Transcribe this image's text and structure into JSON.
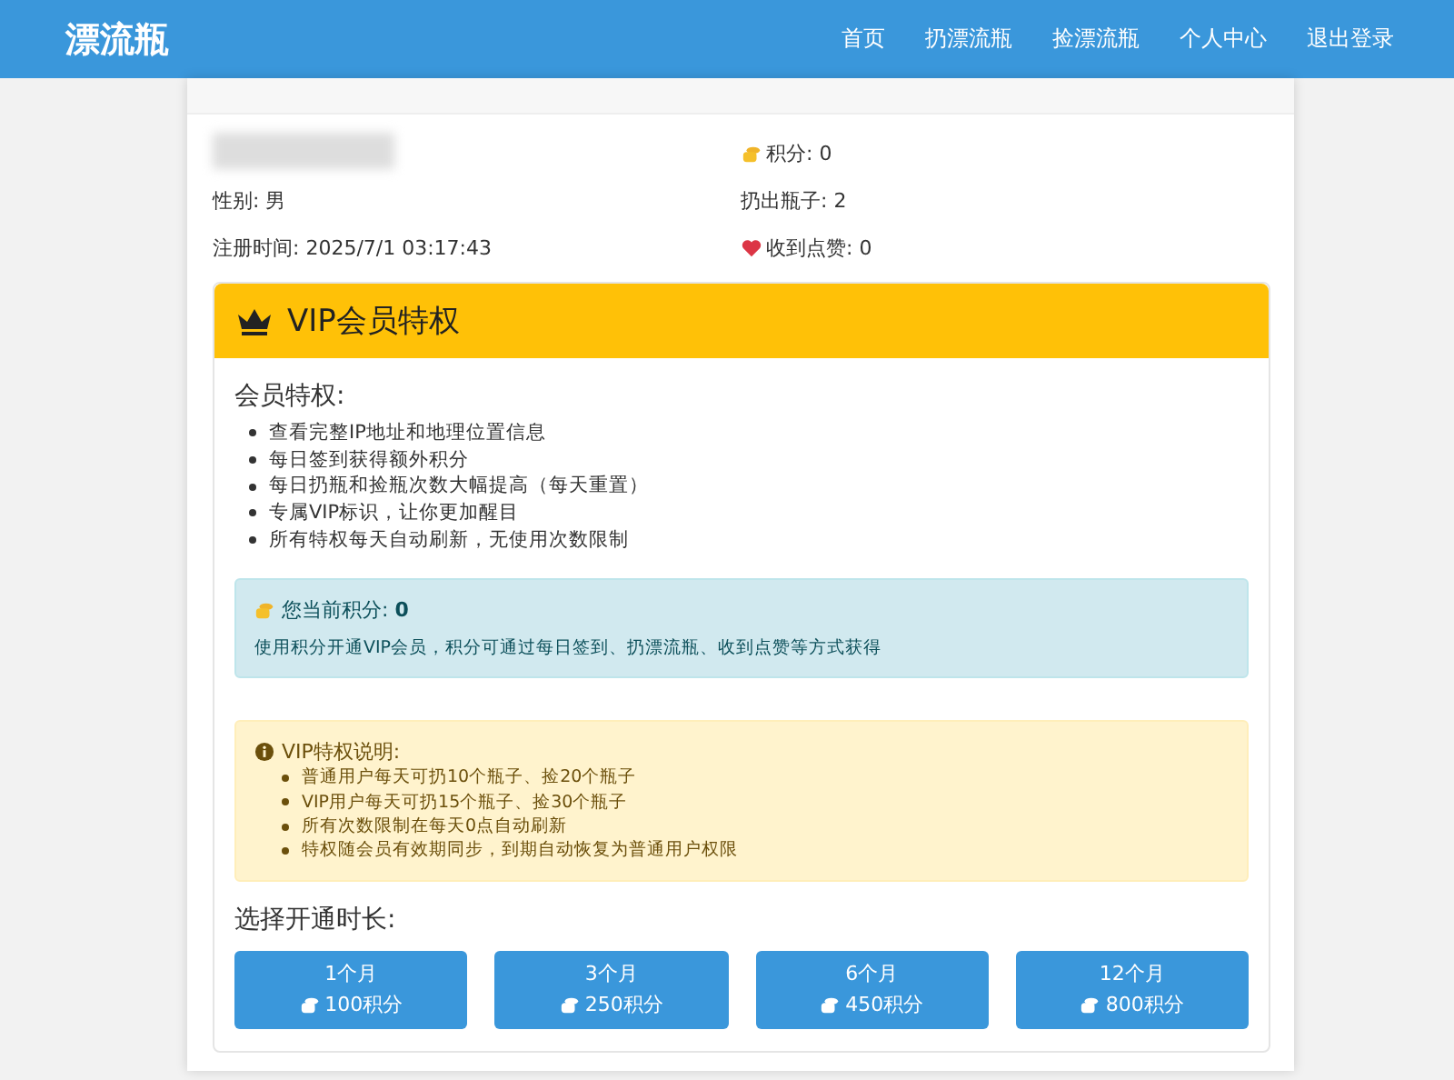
{
  "navbar": {
    "brand": "漂流瓶",
    "links": [
      "首页",
      "扔漂流瓶",
      "捡漂流瓶",
      "个人中心",
      "退出登录"
    ]
  },
  "profile": {
    "left": [
      {
        "text": "性别: 男"
      },
      {
        "text": "注册时间: 2025/7/1 03:17:43"
      }
    ],
    "right": [
      {
        "kind": "coins",
        "text": "积分: 0"
      },
      {
        "kind": "text",
        "text": "扔出瓶子: 2"
      },
      {
        "kind": "heart",
        "text": "收到点赞: 0"
      }
    ]
  },
  "vip": {
    "title": "VIP会员特权",
    "benefits_title": "会员特权:",
    "benefits": [
      "查看完整IP地址和地理位置信息",
      "每日签到获得额外积分",
      "每日扔瓶和捡瓶次数大幅提高（每天重置）",
      "专属VIP标识，让你更加醒目",
      "所有特权每天自动刷新，无使用次数限制"
    ],
    "points": {
      "label": "您当前积分: **0**",
      "note": "使用积分开通VIP会员，积分可通过每日签到、扔漂流瓶、收到点赞等方式获得"
    },
    "notice": {
      "title": "VIP特权说明:",
      "items": [
        "普通用户每天可扔10个瓶子、捡20个瓶子",
        "VIP用户每天可扔15个瓶子、捡30个瓶子",
        "所有次数限制在每天0点自动刷新",
        "特权随会员有效期同步，到期自动恢复为普通用户权限"
      ]
    },
    "plans_title": "选择开通时长:",
    "plans": [
      {
        "duration": "1个月",
        "price": "100积分"
      },
      {
        "duration": "3个月",
        "price": "250积分"
      },
      {
        "duration": "6个月",
        "price": "450积分"
      },
      {
        "duration": "12个月",
        "price": "800积分"
      }
    ]
  }
}
